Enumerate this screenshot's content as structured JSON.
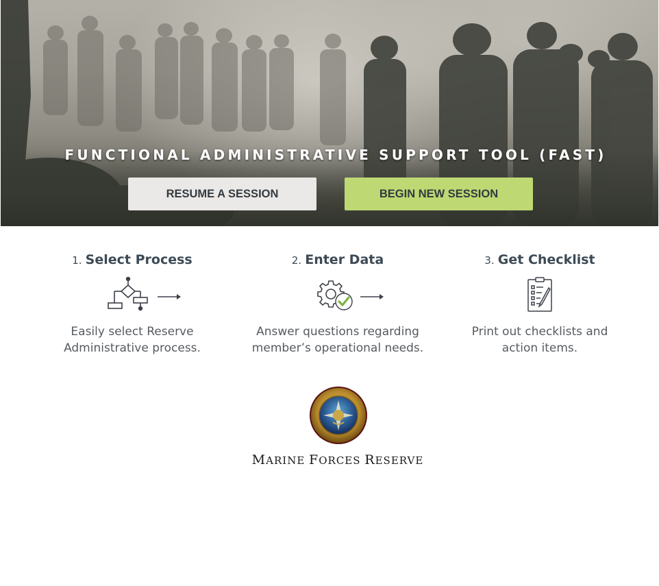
{
  "hero": {
    "title": "FUNCTIONAL ADMINISTRATIVE SUPPORT TOOL (FAST)",
    "resume_label": "RESUME A SESSION",
    "begin_label": "BEGIN NEW SESSION",
    "colors": {
      "resume_bg": "#ebe9e7",
      "begin_bg": "#bed873",
      "button_text": "#333a3f"
    }
  },
  "steps": [
    {
      "num": "1.",
      "name": "Select Process",
      "icon": "flowchart-icon",
      "desc_line1": "Easily select Reserve",
      "desc_line2": "Administrative process."
    },
    {
      "num": "2.",
      "name": "Enter Data",
      "icon": "gear-check-icon",
      "desc_line1": "Answer questions regarding",
      "desc_line2": "member’s operational needs."
    },
    {
      "num": "3.",
      "name": "Get Checklist",
      "icon": "clipboard-checklist-icon",
      "desc_line1": "Print out checklists and",
      "desc_line2": "action items."
    }
  ],
  "org": {
    "name_M": "M",
    "name_rest1": "ARINE ",
    "name_F": "F",
    "name_rest2": "ORCES ",
    "name_R": "R",
    "name_rest3": "ESERVE",
    "seal_icon": "marforres-seal-icon"
  }
}
